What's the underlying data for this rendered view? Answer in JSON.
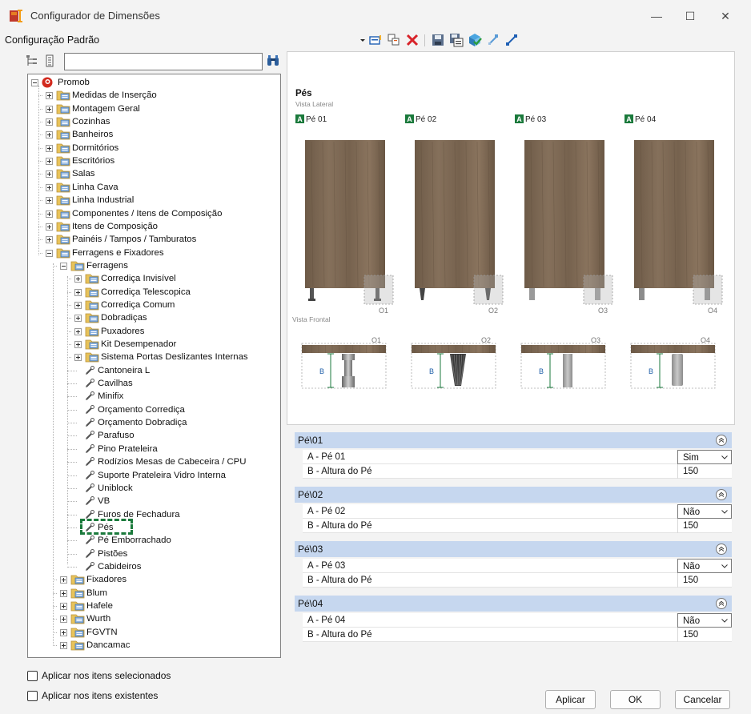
{
  "window": {
    "title": "Configurador de Dimensões",
    "minimize": "—",
    "maximize": "☐",
    "close": "✕"
  },
  "config": {
    "label": "Configuração Padrão"
  },
  "search": {
    "value": "",
    "placeholder": ""
  },
  "tree": [
    {
      "label": "Promob",
      "level": 0,
      "type": "root",
      "expander": "minus"
    },
    {
      "label": "Medidas de Inserção",
      "level": 1,
      "type": "folder",
      "expander": "plus"
    },
    {
      "label": "Montagem Geral",
      "level": 1,
      "type": "folder",
      "expander": "plus"
    },
    {
      "label": "Cozinhas",
      "level": 1,
      "type": "folder",
      "expander": "plus"
    },
    {
      "label": "Banheiros",
      "level": 1,
      "type": "folder",
      "expander": "plus"
    },
    {
      "label": "Dormitórios",
      "level": 1,
      "type": "folder",
      "expander": "plus"
    },
    {
      "label": "Escritórios",
      "level": 1,
      "type": "folder",
      "expander": "plus"
    },
    {
      "label": "Salas",
      "level": 1,
      "type": "folder",
      "expander": "plus"
    },
    {
      "label": "Linha Cava",
      "level": 1,
      "type": "folder",
      "expander": "plus"
    },
    {
      "label": "Linha Industrial",
      "level": 1,
      "type": "folder",
      "expander": "plus"
    },
    {
      "label": "Componentes / Itens de Composição",
      "level": 1,
      "type": "folder",
      "expander": "plus"
    },
    {
      "label": "Itens de Composição",
      "level": 1,
      "type": "folder",
      "expander": "plus"
    },
    {
      "label": "Painéis / Tampos / Tamburatos",
      "level": 1,
      "type": "folder",
      "expander": "plus"
    },
    {
      "label": "Ferragens e Fixadores",
      "level": 1,
      "type": "folder",
      "expander": "minus"
    },
    {
      "label": "Ferragens",
      "level": 2,
      "type": "folder",
      "expander": "minus"
    },
    {
      "label": "Corrediça Invisível",
      "level": 3,
      "type": "folder",
      "expander": "plus"
    },
    {
      "label": "Corrediça Telescopica",
      "level": 3,
      "type": "folder",
      "expander": "plus"
    },
    {
      "label": "Corrediça Comum",
      "level": 3,
      "type": "folder",
      "expander": "plus"
    },
    {
      "label": "Dobradiças",
      "level": 3,
      "type": "folder",
      "expander": "plus"
    },
    {
      "label": "Puxadores",
      "level": 3,
      "type": "folder",
      "expander": "plus"
    },
    {
      "label": "Kit Desempenador",
      "level": 3,
      "type": "folder",
      "expander": "plus"
    },
    {
      "label": "Sistema Portas Deslizantes Internas",
      "level": 3,
      "type": "folder",
      "expander": "plus"
    },
    {
      "label": "Cantoneira L",
      "level": 3,
      "type": "item"
    },
    {
      "label": "Cavilhas",
      "level": 3,
      "type": "item"
    },
    {
      "label": "Minifix",
      "level": 3,
      "type": "item"
    },
    {
      "label": "Orçamento Corrediça",
      "level": 3,
      "type": "item"
    },
    {
      "label": "Orçamento Dobradiça",
      "level": 3,
      "type": "item"
    },
    {
      "label": "Parafuso",
      "level": 3,
      "type": "item"
    },
    {
      "label": "Pino Prateleira",
      "level": 3,
      "type": "item"
    },
    {
      "label": "Rodízios Mesas de Cabeceira / CPU",
      "level": 3,
      "type": "item"
    },
    {
      "label": "Suporte Prateleira Vidro Interna",
      "level": 3,
      "type": "item"
    },
    {
      "label": "Uniblock",
      "level": 3,
      "type": "item"
    },
    {
      "label": "VB",
      "level": 3,
      "type": "item"
    },
    {
      "label": "Furos de Fechadura",
      "level": 3,
      "type": "item"
    },
    {
      "label": "Pés",
      "level": 3,
      "type": "item",
      "selected": true
    },
    {
      "label": "Pé Emborrachado",
      "level": 3,
      "type": "item"
    },
    {
      "label": "Pistões",
      "level": 3,
      "type": "item"
    },
    {
      "label": "Cabideiros",
      "level": 3,
      "type": "item"
    },
    {
      "label": "Fixadores",
      "level": 2,
      "type": "folder",
      "expander": "plus"
    },
    {
      "label": "Blum",
      "level": 2,
      "type": "folder",
      "expander": "plus"
    },
    {
      "label": "Hafele",
      "level": 2,
      "type": "folder",
      "expander": "plus"
    },
    {
      "label": "Wurth",
      "level": 2,
      "type": "folder",
      "expander": "plus"
    },
    {
      "label": "FGVTN",
      "level": 2,
      "type": "folder",
      "expander": "plus"
    },
    {
      "label": "Dancamac",
      "level": 2,
      "type": "folder",
      "expander": "plus"
    }
  ],
  "options": {
    "apply_selected": {
      "label": "Aplicar nos itens selecionados",
      "checked": false
    },
    "apply_existing": {
      "label": "Aplicar nos itens existentes",
      "checked": false
    }
  },
  "preview": {
    "title": "Pés",
    "side_view_label": "Vista Lateral",
    "front_view_label": "Vista Frontal",
    "badge_letter": "A",
    "dimension_letter": "B",
    "feet": [
      {
        "label": "Pé 01",
        "code": "O1"
      },
      {
        "label": "Pé 02",
        "code": "O2"
      },
      {
        "label": "Pé 03",
        "code": "O3"
      },
      {
        "label": "Pé 04",
        "code": "O4"
      }
    ]
  },
  "properties": [
    {
      "group": "Pé\\01",
      "rows": [
        {
          "name": "A - Pé 01",
          "value": "Sim",
          "select": true
        },
        {
          "name": "B - Altura do Pé",
          "value": "150",
          "select": false
        }
      ]
    },
    {
      "group": "Pé\\02",
      "rows": [
        {
          "name": "A - Pé 02",
          "value": "Não",
          "select": true
        },
        {
          "name": "B - Altura do Pé",
          "value": "150",
          "select": false
        }
      ]
    },
    {
      "group": "Pé\\03",
      "rows": [
        {
          "name": "A - Pé 03",
          "value": "Não",
          "select": true
        },
        {
          "name": "B - Altura do Pé",
          "value": "150",
          "select": false
        }
      ]
    },
    {
      "group": "Pé\\04",
      "rows": [
        {
          "name": "A - Pé 04",
          "value": "Não",
          "select": true
        },
        {
          "name": "B - Altura do Pé",
          "value": "150",
          "select": false
        }
      ]
    }
  ],
  "buttons": {
    "apply": "Aplicar",
    "ok": "OK",
    "cancel": "Cancelar"
  },
  "colors": {
    "accent_green": "#1b7a3c",
    "group_header": "#c6d7ef",
    "wood": "#7d6a55",
    "folder": "#e8c35a",
    "promob_red": "#d22a1e"
  }
}
